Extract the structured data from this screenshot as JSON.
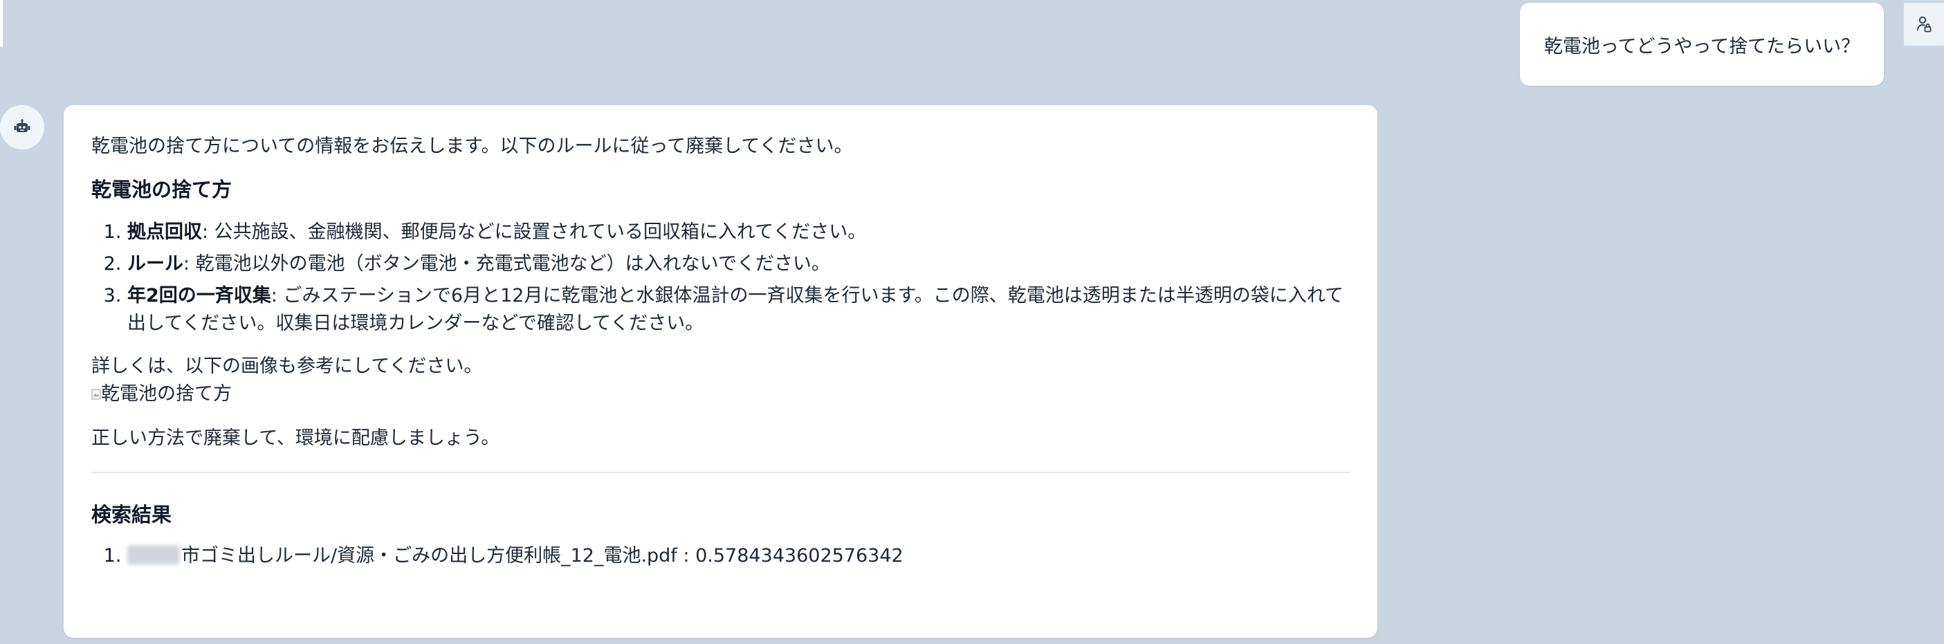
{
  "user_message": {
    "text": "乾電池ってどうやって捨てたらいい？"
  },
  "assistant_message": {
    "intro": "乾電池の捨て方についての情報をお伝えします。以下のルールに従って廃棄してください。",
    "section_heading": "乾電池の捨て方",
    "rules": [
      {
        "term": "拠点回収",
        "text": ": 公共施設、金融機関、郵便局などに設置されている回収箱に入れてください。"
      },
      {
        "term": "ルール",
        "text": ": 乾電池以外の電池（ボタン電池・充電式電池など）は入れないでください。"
      },
      {
        "term": "年2回の一斉収集",
        "text": ": ごみステーションで6月と12月に乾電池と水銀体温計の一斉収集を行います。この際、乾電池は透明または半透明の袋に入れて出してください。収集日は環境カレンダーなどで確認してください。"
      }
    ],
    "details": "詳しくは、以下の画像も参考にしてください。",
    "image_alt": "乾電池の捨て方",
    "closing": "正しい方法で廃棄して、環境に配慮しましょう。",
    "results_heading": "検索結果",
    "results": [
      {
        "text": "市ゴミ出しルール/資源・ごみの出し方便利帳_12_電池.pdf : 0.5784343602576342"
      }
    ]
  },
  "icons": {
    "user": "person-lock-icon",
    "assistant": "robot-icon",
    "image": "broken-image-icon"
  },
  "colors": {
    "background": "#cbd5e1",
    "card": "#ffffff",
    "text": "#1f2937"
  }
}
